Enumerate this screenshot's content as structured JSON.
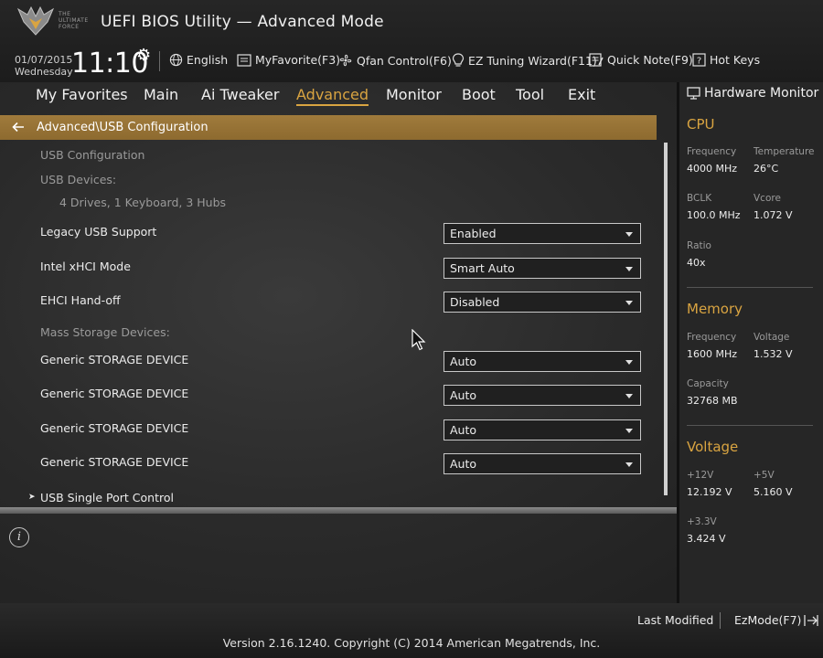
{
  "header": {
    "logo_text": "THE ULTIMATE FORCE",
    "title": "UEFI BIOS Utility — Advanced Mode",
    "date": "01/07/2015",
    "weekday": "Wednesday",
    "time": "11:10",
    "tools": {
      "language": "English",
      "myfavorite": "MyFavorite(F3)",
      "qfan": "Qfan Control(F6)",
      "ez_tuning": "EZ Tuning Wizard(F11)",
      "quick_note": "Quick Note(F9)",
      "hot_keys": "Hot Keys"
    }
  },
  "nav": {
    "tabs": [
      "My Favorites",
      "Main",
      "Ai Tweaker",
      "Advanced",
      "Monitor",
      "Boot",
      "Tool",
      "Exit"
    ],
    "active": "Advanced"
  },
  "breadcrumb": "Advanced\\USB Configuration",
  "content": {
    "usb_configuration": "USB Configuration",
    "usb_devices_label": "USB Devices:",
    "usb_devices_value": "4 Drives, 1 Keyboard, 3 Hubs",
    "legacy_usb": {
      "label": "Legacy USB Support",
      "value": "Enabled"
    },
    "xhci_mode": {
      "label": "Intel xHCI Mode",
      "value": "Smart Auto"
    },
    "ehci_handoff": {
      "label": "EHCI Hand-off",
      "value": "Disabled"
    },
    "mass_storage_label": "Mass Storage Devices:",
    "storage": [
      {
        "label": "Generic STORAGE DEVICE",
        "value": "Auto"
      },
      {
        "label": "Generic STORAGE DEVICE",
        "value": "Auto"
      },
      {
        "label": "Generic STORAGE DEVICE",
        "value": "Auto"
      },
      {
        "label": "Generic STORAGE DEVICE",
        "value": "Auto"
      }
    ],
    "single_port": "USB Single Port Control"
  },
  "hw_monitor": {
    "title": "Hardware Monitor",
    "cpu": {
      "heading": "CPU",
      "frequency_label": "Frequency",
      "frequency": "4000 MHz",
      "temperature_label": "Temperature",
      "temperature": "26°C",
      "bclk_label": "BCLK",
      "bclk": "100.0 MHz",
      "vcore_label": "Vcore",
      "vcore": "1.072 V",
      "ratio_label": "Ratio",
      "ratio": "40x"
    },
    "memory": {
      "heading": "Memory",
      "frequency_label": "Frequency",
      "frequency": "1600 MHz",
      "voltage_label": "Voltage",
      "voltage": "1.532 V",
      "capacity_label": "Capacity",
      "capacity": "32768 MB"
    },
    "voltage": {
      "heading": "Voltage",
      "v12_label": "+12V",
      "v12": "12.192 V",
      "v5_label": "+5V",
      "v5": "5.160 V",
      "v33_label": "+3.3V",
      "v33": "3.424 V"
    }
  },
  "footer": {
    "last_modified": "Last Modified",
    "ezmode": "EzMode(F7)",
    "copyright": "Version 2.16.1240. Copyright (C) 2014 American Megatrends, Inc."
  },
  "colors": {
    "accent": "#d9a441",
    "breadcrumb_bg": "#9a7436"
  }
}
